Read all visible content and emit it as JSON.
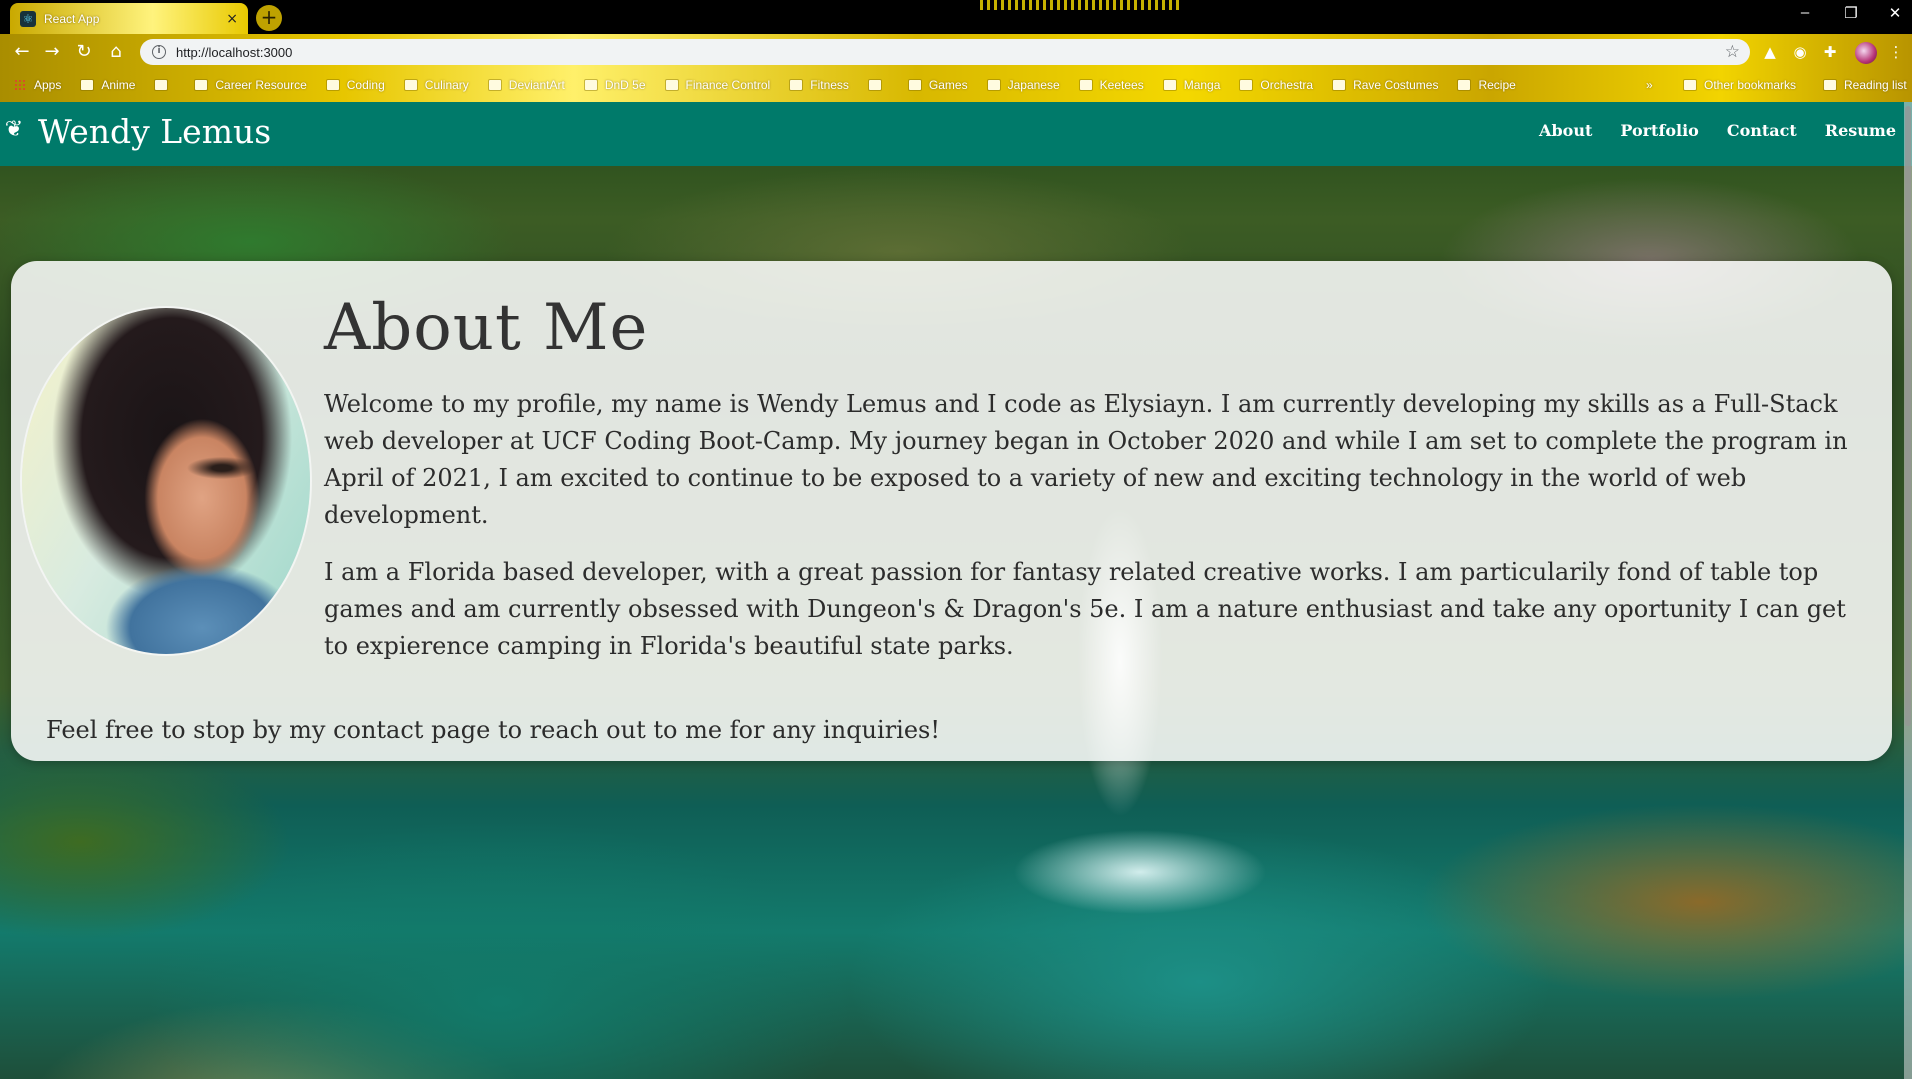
{
  "browser": {
    "tab": {
      "title": "React App",
      "close": "×"
    },
    "new_tab": "+",
    "window_controls": {
      "minimize": "–",
      "restore": "❐",
      "close": "✕"
    },
    "nav": {
      "back": "←",
      "forward": "→",
      "reload": "↻",
      "home": "⌂"
    },
    "address": {
      "info": "i",
      "url": "http://localhost:3000",
      "star": "☆"
    },
    "extensions": {
      "drive": "▲",
      "camera": "◉",
      "puzzle": "✚",
      "menu": "⋮"
    },
    "bookmarks": [
      {
        "label": "Apps",
        "type": "apps"
      },
      {
        "label": "Anime",
        "type": "folder"
      },
      {
        "label": "",
        "type": "folder"
      },
      {
        "label": "Career Resource",
        "type": "folder"
      },
      {
        "label": "Coding",
        "type": "folder"
      },
      {
        "label": "Culinary",
        "type": "folder"
      },
      {
        "label": "DeviantArt",
        "type": "folder"
      },
      {
        "label": "DnD 5e",
        "type": "folder"
      },
      {
        "label": "Finance Control",
        "type": "folder"
      },
      {
        "label": "Fitness",
        "type": "folder"
      },
      {
        "label": "",
        "type": "folder"
      },
      {
        "label": "Games",
        "type": "folder"
      },
      {
        "label": "Japanese",
        "type": "folder"
      },
      {
        "label": "Keetees",
        "type": "folder"
      },
      {
        "label": "Manga",
        "type": "folder"
      },
      {
        "label": "Orchestra",
        "type": "folder"
      },
      {
        "label": "Rave Costumes",
        "type": "folder"
      },
      {
        "label": "Recipe",
        "type": "folder"
      }
    ],
    "bookmarks_overflow": "»",
    "other_bookmarks": "Other bookmarks",
    "reading_list": "Reading list"
  },
  "site": {
    "brand_icon": "❦",
    "brand_name": "Wendy Lemus",
    "nav": [
      "About",
      "Portfolio",
      "Contact",
      "Resume"
    ]
  },
  "about": {
    "heading": "About Me",
    "paragraphs": [
      "Welcome to my profile, my name is Wendy Lemus and I code as Elysiayn. I am currently developing my skills as a Full-Stack web developer at UCF Coding Boot-Camp. My journey began in October 2020 and while I am set to complete the program in April of 2021, I am excited to continue to be exposed to a variety of new and exciting technology in the world of web development.",
      "I am a Florida based developer, with a great passion for fantasy related creative works. I am particularily fond of table top games and am currently obsessed with Dungeon's & Dragon's 5e. I am a nature enthusiast and take any oportunity I can get to expierence camping in Florida's beautiful state parks.",
      "Feel free to stop by my contact page to reach out to me for any inquiries!"
    ]
  }
}
